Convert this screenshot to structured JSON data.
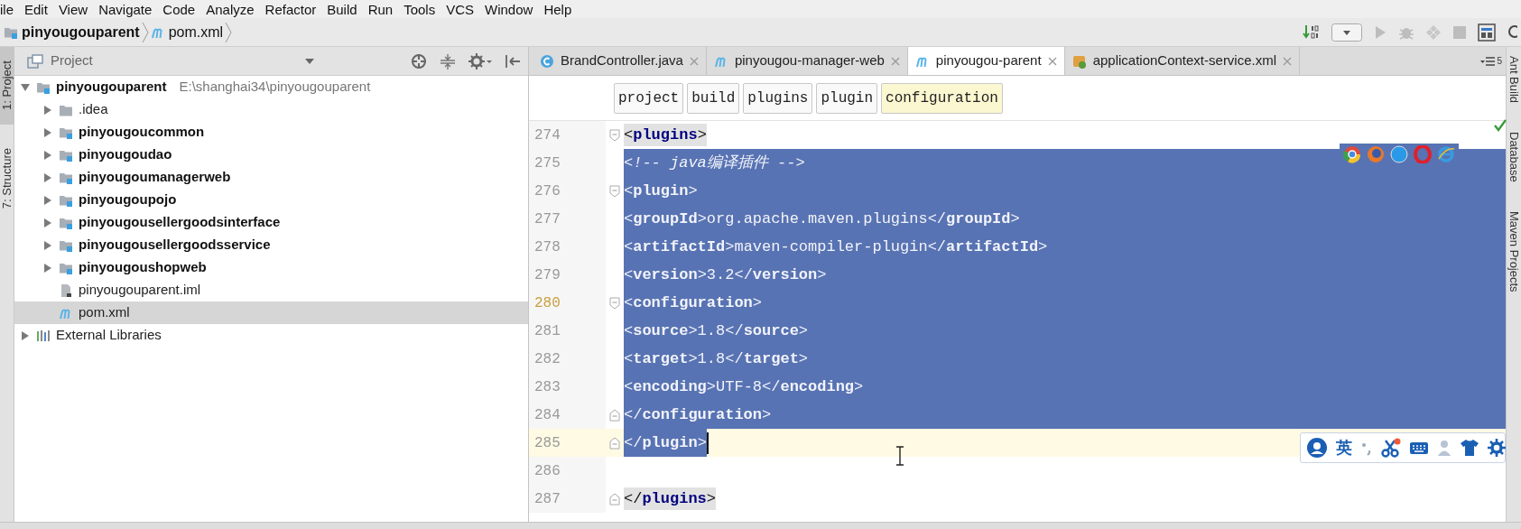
{
  "menu": [
    "ile",
    "Edit",
    "View",
    "Navigate",
    "Code",
    "Analyze",
    "Refactor",
    "Build",
    "Run",
    "Tools",
    "VCS",
    "Window",
    "Help"
  ],
  "breadcrumb": [
    {
      "kind": "module",
      "label": "pinyougouparent"
    },
    {
      "kind": "pom",
      "label": "pom.xml"
    }
  ],
  "left_stripe": [
    {
      "label": "1: Project",
      "selected": true
    },
    {
      "label": "7: Structure",
      "selected": false
    }
  ],
  "project_panel": {
    "title": "Project",
    "tree": [
      {
        "kind": "root",
        "label": "pinyougouparent",
        "path": "E:\\shanghai34\\pinyougouparent",
        "expanded": true,
        "selected": false,
        "children": [
          {
            "kind": "folder",
            "label": ".idea",
            "expanded": false,
            "selected": false
          },
          {
            "kind": "module",
            "label": "pinyougoucommon",
            "expanded": false,
            "selected": false
          },
          {
            "kind": "module",
            "label": "pinyougoudao",
            "expanded": false,
            "selected": false
          },
          {
            "kind": "module",
            "label": "pinyougoumanagerweb",
            "expanded": false,
            "selected": false
          },
          {
            "kind": "module",
            "label": "pinyougoupojo",
            "expanded": false,
            "selected": false
          },
          {
            "kind": "module",
            "label": "pinyougousellergoodsinterface",
            "expanded": false,
            "selected": false
          },
          {
            "kind": "module",
            "label": "pinyougousellergoodsservice",
            "expanded": false,
            "selected": false
          },
          {
            "kind": "module",
            "label": "pinyougoushopweb",
            "expanded": false,
            "selected": false
          },
          {
            "kind": "iml",
            "label": "pinyougouparent.iml",
            "selected": false
          },
          {
            "kind": "pom",
            "label": "pom.xml",
            "selected": true
          }
        ]
      },
      {
        "kind": "libraries",
        "label": "External Libraries",
        "expanded": false,
        "selected": false
      }
    ]
  },
  "editor_tabs": [
    {
      "kind": "java",
      "label": "BrandController.java",
      "selected": false
    },
    {
      "kind": "pom",
      "label": "pinyougou-manager-web",
      "selected": false
    },
    {
      "kind": "pom",
      "label": "pinyougou-parent",
      "selected": true
    },
    {
      "kind": "spring",
      "label": "applicationContext-service.xml",
      "selected": false
    }
  ],
  "tab_count": "5",
  "xml_path": [
    {
      "label": "project",
      "selected": false
    },
    {
      "label": "build",
      "selected": false
    },
    {
      "label": "plugins",
      "selected": false
    },
    {
      "label": "plugin",
      "selected": false
    },
    {
      "label": "configuration",
      "selected": true
    }
  ],
  "lines": [
    {
      "number": "274",
      "kind": "tag",
      "code": "        <**plugins**>",
      "selected": false,
      "fold_start": true,
      "fold_end": false,
      "tag_match": true,
      "current": false,
      "marked": false
    },
    {
      "number": "275",
      "kind": "comment",
      "code": "            <!-- java编译插件 -->",
      "selected": true,
      "fold_start": false,
      "fold_end": false,
      "tag_match": false,
      "current": false,
      "marked": false
    },
    {
      "number": "276",
      "kind": "tag",
      "code": "            <**plugin**>",
      "selected": true,
      "fold_start": true,
      "fold_end": false,
      "tag_match": false,
      "current": false,
      "marked": false
    },
    {
      "number": "277",
      "kind": "tag",
      "code": "                <**groupId**>org.apache.maven.plugins</**groupId**>",
      "selected": true,
      "fold_start": false,
      "fold_end": false,
      "tag_match": false,
      "current": false,
      "marked": false
    },
    {
      "number": "278",
      "kind": "tag",
      "code": "                <**artifactId**>maven-compiler-plugin</**artifactId**>",
      "selected": true,
      "fold_start": false,
      "fold_end": false,
      "tag_match": false,
      "current": false,
      "marked": false
    },
    {
      "number": "279",
      "kind": "tag",
      "code": "                <**version**>3.2</**version**>",
      "selected": true,
      "fold_start": false,
      "fold_end": false,
      "tag_match": false,
      "current": false,
      "marked": false
    },
    {
      "number": "280",
      "kind": "tag",
      "code": "                <**configuration**>",
      "selected": true,
      "fold_start": true,
      "fold_end": false,
      "tag_match": false,
      "current": false,
      "marked": true
    },
    {
      "number": "281",
      "kind": "tag",
      "code": "                    <**source**>1.8</**source**>",
      "selected": true,
      "fold_start": false,
      "fold_end": false,
      "tag_match": false,
      "current": false,
      "marked": false
    },
    {
      "number": "282",
      "kind": "tag",
      "code": "                    <**target**>1.8</**target**>",
      "selected": true,
      "fold_start": false,
      "fold_end": false,
      "tag_match": false,
      "current": false,
      "marked": false
    },
    {
      "number": "283",
      "kind": "tag",
      "code": "                    <**encoding**>UTF-8</**encoding**>",
      "selected": true,
      "fold_start": false,
      "fold_end": false,
      "tag_match": false,
      "current": false,
      "marked": false
    },
    {
      "number": "284",
      "kind": "tag",
      "code": "                </**configuration**>",
      "selected": true,
      "fold_start": false,
      "fold_end": true,
      "tag_match": false,
      "current": false,
      "marked": false
    },
    {
      "number": "285",
      "kind": "tag",
      "code": "            </**plugin**>",
      "selected": true,
      "fold_start": false,
      "fold_end": true,
      "tag_match": false,
      "current": true,
      "marked": false
    },
    {
      "number": "286",
      "selected": false,
      "fold_start": false,
      "fold_end": false,
      "current": false,
      "marked": false
    },
    {
      "number": "287",
      "kind": "tag",
      "code": "        </**plugins**>",
      "selected": false,
      "fold_start": false,
      "fold_end": true,
      "tag_match": true,
      "current": false,
      "marked": false
    }
  ],
  "right_stripe": [
    "Ant Build",
    "Database",
    "Maven Projects"
  ],
  "ime_toolbar": {
    "mode": "英"
  }
}
